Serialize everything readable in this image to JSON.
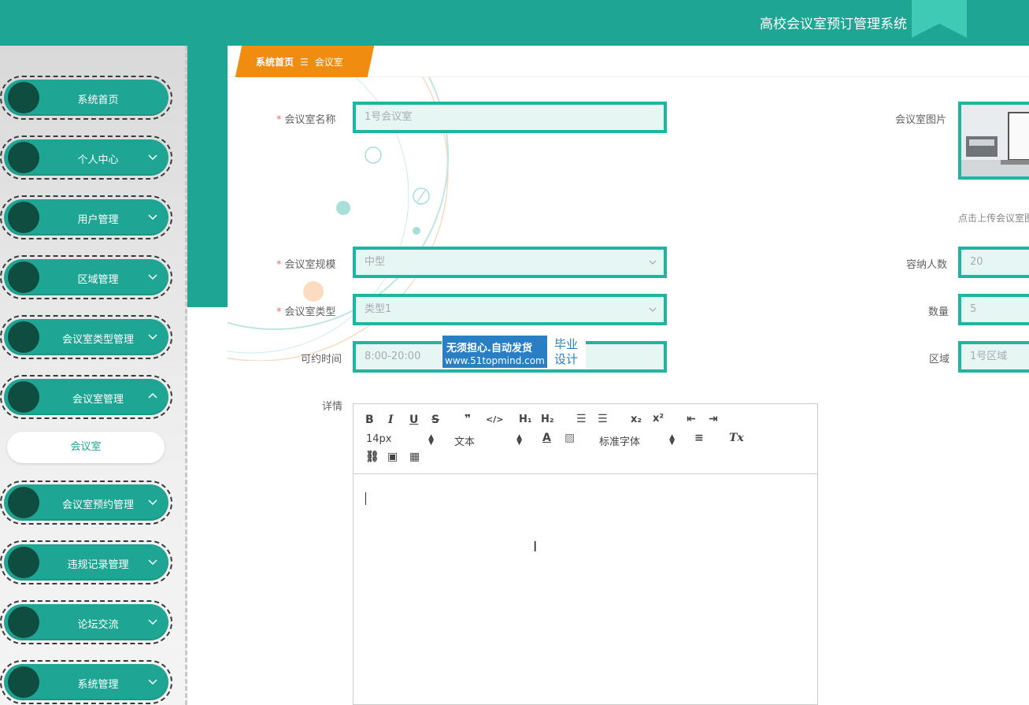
{
  "header": {
    "title": "高校会议室预订管理系统"
  },
  "sidebar": {
    "items": [
      {
        "label": "系统首页",
        "chevron": ""
      },
      {
        "label": "个人中心",
        "chevron": "down"
      },
      {
        "label": "用户管理",
        "chevron": "down"
      },
      {
        "label": "区域管理",
        "chevron": "down"
      },
      {
        "label": "会议室类型管理",
        "chevron": "down"
      },
      {
        "label": "会议室管理",
        "chevron": "up"
      },
      {
        "label": "会议室预约管理",
        "chevron": "down"
      },
      {
        "label": "违规记录管理",
        "chevron": "down"
      },
      {
        "label": "论坛交流",
        "chevron": "down"
      },
      {
        "label": "系统管理",
        "chevron": "down"
      }
    ],
    "sub_item": "会议室"
  },
  "breadcrumb": {
    "home": "系统首页",
    "separator": "☰",
    "current": "会议室"
  },
  "form": {
    "name": {
      "label": "会议室名称",
      "value": "1号会议室"
    },
    "image": {
      "label": "会议室图片",
      "hint": "点击上传会议室图"
    },
    "scale": {
      "label": "会议室规模",
      "value": "中型"
    },
    "capacity": {
      "label": "容纳人数",
      "value": "20"
    },
    "type": {
      "label": "会议室类型",
      "value": "类型1"
    },
    "quantity": {
      "label": "数量",
      "value": "5"
    },
    "time": {
      "label": "可约时间",
      "value": "8:00-20:00"
    },
    "area": {
      "label": "区域",
      "value": "1号区域"
    },
    "detail": {
      "label": "详情"
    }
  },
  "watermark": {
    "line1": "无须担心.自动发货",
    "line2": "www.51topmind.com",
    "box1": "毕业",
    "box2": "设计"
  },
  "editor": {
    "font_size": "14px",
    "paragraph": "文本",
    "font_family": "标准字体"
  },
  "colors": {
    "primary": "#1fa593",
    "accent": "#f08c0f",
    "input_border": "#1fb5a1",
    "menu_dot": "#0f4d40"
  }
}
